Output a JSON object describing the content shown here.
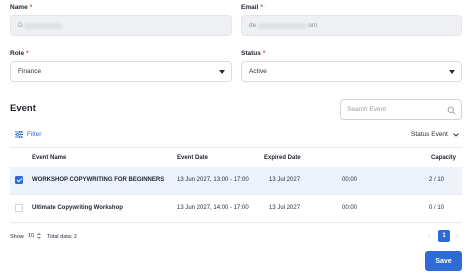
{
  "form": {
    "name_label": "Name",
    "name_value": "D",
    "email_label": "Email",
    "email_prefix": "de",
    "email_suffix": "om",
    "role_label": "Role",
    "role_value": "Finance",
    "status_label": "Status",
    "status_value": "Active",
    "required_mark": "*"
  },
  "event_section": {
    "title": "Event",
    "search_placeholder": "Search Event",
    "filter_label": "Filter",
    "status_filter_label": "Status Event"
  },
  "table": {
    "headers": [
      "Event Name",
      "Event Date",
      "Expired Date",
      "Capacity"
    ],
    "rows": [
      {
        "selected": true,
        "name": "WORKSHOP COPYWRITING FOR BEGINNERS",
        "event_date": "13 Jun 2027, 13:00 - 17:00",
        "expired_date": "13 Jul 2027",
        "expired_time": "00:00",
        "capacity": "2 / 10"
      },
      {
        "selected": false,
        "name": "Ultimate Copywriting Workshop",
        "event_date": "13 Jun 2027, 14:00 - 17:00",
        "expired_date": "13 Jul 2027",
        "expired_time": "00:00",
        "capacity": "0 / 10"
      }
    ]
  },
  "footer": {
    "show_label": "Show",
    "show_value": "10",
    "total_label": "Total data: 2",
    "current_page": "1",
    "prev_icon": "‹",
    "next_icon": "›",
    "save_label": "Save"
  },
  "colors": {
    "accent": "#2e6bd6",
    "required": "#e04848",
    "selected_row": "#eef3fb"
  }
}
